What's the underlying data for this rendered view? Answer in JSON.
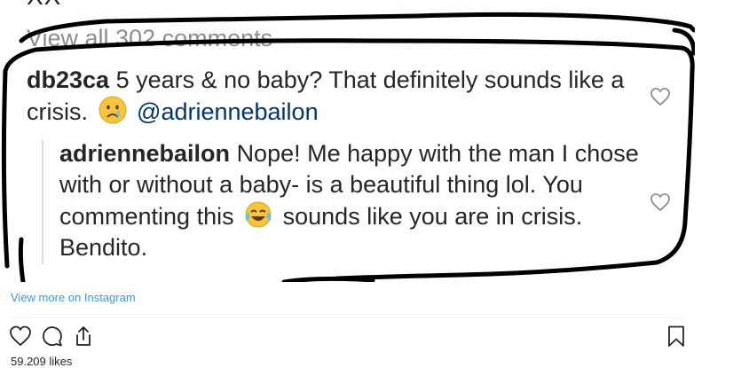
{
  "post": {
    "top_fragment": "XX",
    "view_all_comments": "View all 302 comments",
    "comments": [
      {
        "username": "db23ca",
        "text_before_emoji": "5 years & no baby? That definitely sounds like a crisis.",
        "emoji": "crying-face",
        "mention": "@adriennebailon"
      },
      {
        "username": "adriennebailon",
        "text_before_emoji": "Nope! Me happy with the man I chose with or without a baby- is a beautiful thing lol. You commenting this",
        "emoji": "face-with-tears-of-joy",
        "text_after_emoji": "sounds like you are in crisis. Bendito."
      }
    ]
  },
  "embed": {
    "view_more_link": "View more on Instagram",
    "likes": "59.209 likes",
    "actions": [
      "heart-icon",
      "comment-icon",
      "share-icon",
      "bookmark-icon"
    ]
  },
  "colors": {
    "link": "#3897f0",
    "mention": "#003569",
    "muted": "#8e8e8e",
    "text": "#262626"
  }
}
